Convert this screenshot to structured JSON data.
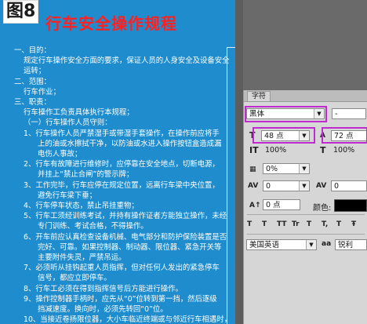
{
  "document": {
    "figure_label": "图8",
    "title": "行车安全操作规程",
    "lines": [
      "一、目的：",
      "规定行车操作安全方面的要求，保证人员的人身安全及设备安全",
      "运转；",
      "二、范围：",
      "行车作业；",
      "三、职责：",
      "行车操作工负责具体执行本规程；",
      "（一）行车操作人员守则：",
      "1、行车操作人员严禁湿手或带湿手套操作，在操作前应将手",
      "上的油或水擦拭干净，以防油或水进入操作按钮盒造成漏",
      "电伤人事故；",
      "2、行车有故障进行维修时，应停靠在安全地点，切断电源，",
      "并挂上“禁止合闸”的警示牌；",
      "3、工作完毕，行车应停在规定位置，远离行车梁中央位置，",
      "避免行车梁下垂；",
      "4、行车停车状态，禁止吊挂重物；",
      "5、行车工须经训练考试，并持有操作证者方能独立操作，未经",
      "专门训练、考试合格，不得操作。",
      "6、开车前应认真检查设备机械、电气部分和防护保险装置是否",
      "完好、可靠。如果控制器、制动器、限位器、紧急开关等",
      "主要附件失灵，严禁吊运。",
      "7、必须听从挂钩起重人员指挥，但对任何人发出的紧急停车",
      "信号，都应立即停车。",
      "8、行车工必须在得到指挥信号后方能进行操作。",
      "9、操作控制器手柄时，应先从“0”位转到第一挡，然后逐级",
      "挡减速度。换向时，必须先转回“0”位。",
      "10、当接近卷扬限位器，大小车临近终端或与邻近行车相遇时，"
    ]
  },
  "panel": {
    "tab_label": "字符",
    "font_family": "黑体",
    "font_style": "-",
    "font_size": "48 点",
    "leading": "72 点",
    "vertical_scale": "100%",
    "horizontal_scale": "100%",
    "tracking_ratio": "0%",
    "kerning": "0",
    "tracking": "0",
    "baseline_shift": "0 点",
    "color_label": "颜色:",
    "style_buttons": [
      "T",
      "T",
      "TT",
      "Tr",
      "T",
      "T,",
      "T",
      "Ŧ"
    ],
    "language": "美国英语",
    "aa_label": "aa",
    "antialias": "锐利",
    "icons": {
      "font_size": "font-size-icon",
      "leading": "leading-icon",
      "vertical_scale": "vertical-scale-icon",
      "horizontal_scale": "horizontal-scale-icon",
      "tracking_ratio": "tracking-ratio-icon",
      "kerning": "kerning-icon",
      "tracking": "tracking-icon",
      "baseline": "baseline-shift-icon"
    },
    "colors": {
      "highlight": "#c02bd0",
      "text_color": "#000000"
    }
  }
}
